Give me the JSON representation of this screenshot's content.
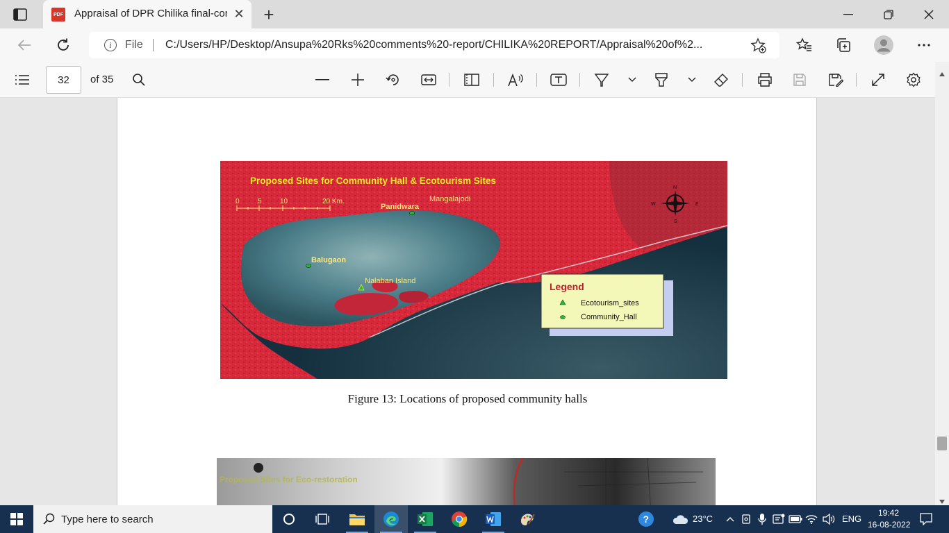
{
  "browser": {
    "tab_title": "Appraisal of DPR Chilika final-cor",
    "tab_icon_text": "PDF",
    "file_label": "File",
    "url": "C:/Users/HP/Desktop/Ansupa%20Rks%20comments%20-report/CHILIKA%20REPORT/Appraisal%20of%2..."
  },
  "pdf_toolbar": {
    "page_number": "32",
    "page_total": "of 35"
  },
  "document": {
    "figure": {
      "title": "Proposed Sites for Community Hall & Ecotourism Sites",
      "scale_ticks": [
        "0",
        "5",
        "10",
        "20 Km."
      ],
      "compass": {
        "n": "N",
        "s": "S",
        "e": "E",
        "w": "W"
      },
      "places": {
        "mangalajodi": "Mangalajodi",
        "panidwara": "Panidwara",
        "balugaon": "Balugaon",
        "nalaban": "Nalaban Island"
      },
      "legend": {
        "title": "Legend",
        "ecotourism": "Ecotourism_sites",
        "community": "Community_Hall"
      }
    },
    "caption": "Figure 13: Locations of proposed community halls",
    "next_figure_title": "Proposed Sites for Eco-restoration"
  },
  "taskbar": {
    "search_placeholder": "Type here to search",
    "weather": "23°C",
    "language": "ENG",
    "time": "19:42",
    "date": "16-08-2022"
  },
  "colors": {
    "land_red": "#d8283a",
    "lagoon": "#3f6f7c",
    "sea": "#1d3a4a",
    "legend_bg": "#f3f8b8",
    "taskbar": "#17304f"
  }
}
